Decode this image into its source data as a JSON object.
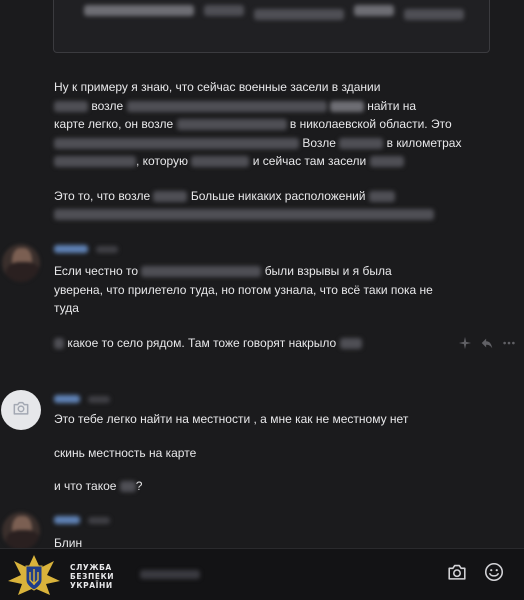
{
  "messages": {
    "first": {
      "p1": {
        "l1": "Ну к примеру я знаю, что сейчас военные засели в здании",
        "l2": "возле",
        "l2b": "найти на",
        "l3": "карте легко, он возле",
        "l3b": "в николаевской области. Это",
        "l4": "Возле",
        "l4b": "в километрах",
        "l5a": ", которую",
        "l5b": "и сейчас там засели"
      },
      "p2": {
        "l1a": "Это то, что возле",
        "l1b": "Больше никаких расположений"
      }
    },
    "second": {
      "p1": {
        "l1a": "Если честно то",
        "l1b": "были взрывы и я была",
        "l2": "уверена, что прилетело туда, но потом узнала, что всё таки пока не",
        "l3": "туда"
      },
      "p2": {
        "l1": "какое то село рядом. Там тоже говорят накрыло"
      }
    },
    "third": {
      "l1": "Это тебе легко найти на местности , а мне как не местному нет",
      "l2": "скинь местность на карте",
      "l3a": "и что такое",
      "l3b": "?"
    },
    "fourth": {
      "l1": "Блин"
    }
  },
  "watermark": {
    "line1": "СЛУЖБА",
    "line2": "БЕЗПЕКИ",
    "line3": "УКРАЇНИ"
  },
  "colors": {
    "background": "#1b1b1d",
    "text": "#e9e9eb",
    "author_link": "#5f82b5",
    "sbu_blue": "#1f3d8a",
    "sbu_gold": "#d9b33b"
  },
  "icons": {
    "camera_avatar": "camera-icon",
    "composer_camera": "camera-icon",
    "composer_emoji": "smile-icon",
    "reactions": [
      "sparkle-icon",
      "reply-icon",
      "more-icon"
    ]
  }
}
